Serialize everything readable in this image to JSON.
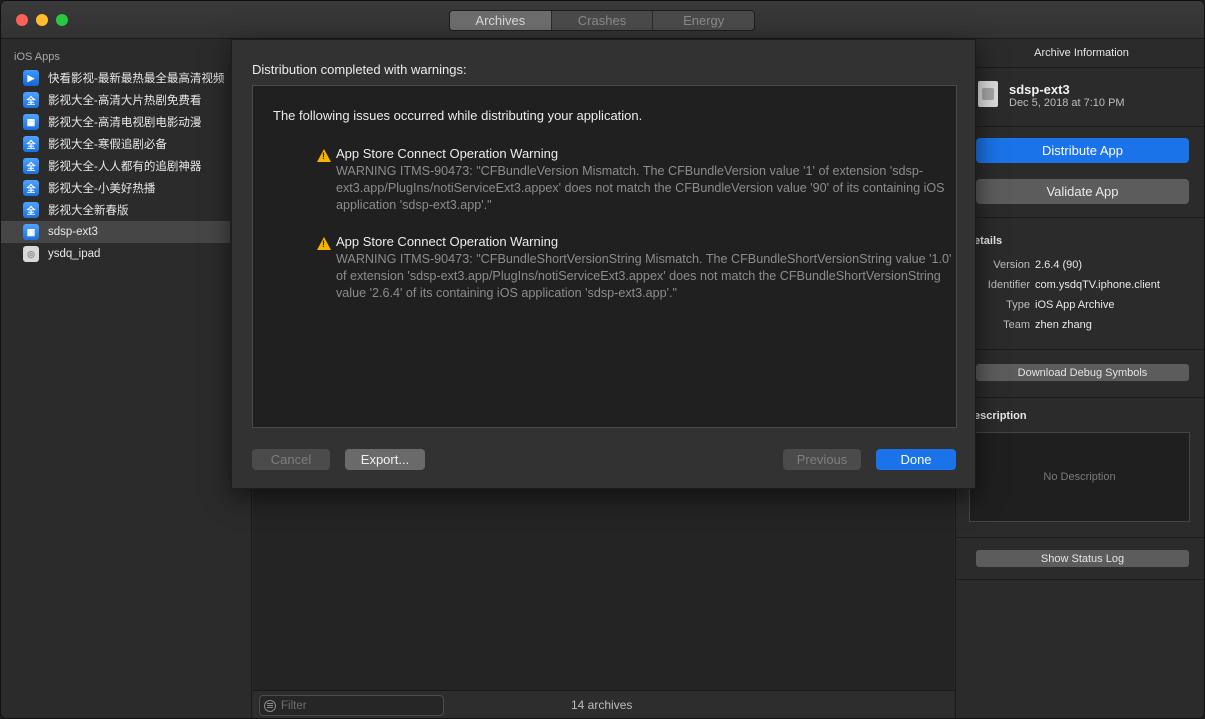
{
  "tabs": [
    "Archives",
    "Crashes",
    "Energy"
  ],
  "sidebar": {
    "header": "iOS Apps",
    "items": [
      {
        "label": "快看影视-最新最热最全最高清视频",
        "icon": "app-icon-kuaikan"
      },
      {
        "label": "影视大全-高清大片热剧免费看",
        "icon": "app-icon-quan"
      },
      {
        "label": "影视大全-高清电视剧电影动漫",
        "icon": "app-icon-quan-alt"
      },
      {
        "label": "影视大全-寒假追剧必备",
        "icon": "app-icon-quan"
      },
      {
        "label": "影视大全-人人都有的追剧神器",
        "icon": "app-icon-quan"
      },
      {
        "label": "影视大全-小美好热播",
        "icon": "app-icon-quan"
      },
      {
        "label": "影视大全新春版",
        "icon": "app-icon-quan"
      },
      {
        "label": "sdsp-ext3",
        "icon": "app-icon-quan-alt"
      },
      {
        "label": "ysdq_ipad",
        "icon": "app-icon-placeholder"
      }
    ]
  },
  "footer": {
    "filter_placeholder": "Filter",
    "archives_count": "14 archives"
  },
  "dialog": {
    "title": "Distribution completed with warnings:",
    "intro": "The following issues occurred while distributing your application.",
    "warnings": [
      {
        "title": "App Store Connect Operation Warning",
        "body": "WARNING ITMS-90473: \"CFBundleVersion Mismatch. The CFBundleVersion value '1' of extension 'sdsp-ext3.app/PlugIns/notiServiceExt3.appex' does not match the CFBundleVersion value '90' of its containing iOS application 'sdsp-ext3.app'.\""
      },
      {
        "title": "App Store Connect Operation Warning",
        "body": "WARNING ITMS-90473: \"CFBundleShortVersionString Mismatch. The CFBundleShortVersionString value '1.0' of extension 'sdsp-ext3.app/PlugIns/notiServiceExt3.appex' does not match the CFBundleShortVersionString value '2.6.4' of its containing iOS application 'sdsp-ext3.app'.\""
      }
    ],
    "cancel": "Cancel",
    "export": "Export...",
    "previous": "Previous",
    "done": "Done"
  },
  "info": {
    "panel_title": "Archive Information",
    "name": "sdsp-ext3",
    "date": "Dec 5, 2018 at 7:10 PM",
    "distribute": "Distribute App",
    "validate": "Validate App",
    "details_label": "etails",
    "version_key": "Version",
    "version_val": "2.6.4 (90)",
    "identifier_key": "Identifier",
    "identifier_val": "com.ysdqTV.iphone.client",
    "type_key": "Type",
    "type_val": "iOS App Archive",
    "team_key": "Team",
    "team_val": "zhen zhang",
    "download_symbols": "Download Debug Symbols",
    "description_label": "escription",
    "no_description": "No Description",
    "status_log": "Show Status Log"
  },
  "colors": {
    "accent": "#1a73e8",
    "warning": "#f7b500"
  }
}
